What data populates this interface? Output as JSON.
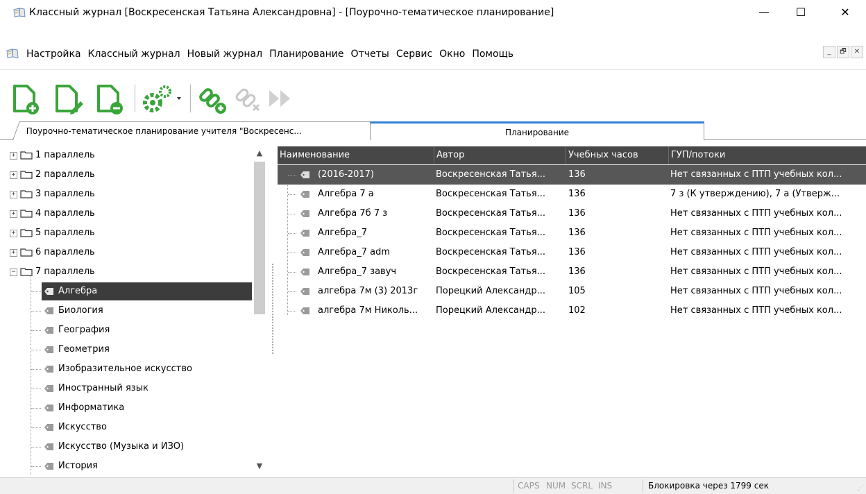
{
  "window": {
    "title": "Классный журнал [Воскресенская  Татьяна  Александровна] - [Поурочно-тематическое планирование]",
    "minimize": "—",
    "maximize": "☐",
    "close": "✕"
  },
  "menu": {
    "items": [
      "Настройка",
      "Классный журнал",
      "Новый журнал",
      "Планирование",
      "Отчеты",
      "Сервис",
      "Окно",
      "Помощь"
    ],
    "mdi_minimize": "_",
    "mdi_restore": "🗗",
    "mdi_close": "✕"
  },
  "toolbar": {
    "icons": [
      "add-document-icon",
      "edit-document-icon",
      "remove-document-icon",
      "settings-gears-icon",
      "add-link-icon",
      "remove-link-icon",
      "forward-icon"
    ],
    "accent_color": "#3aa53a"
  },
  "tabs": [
    {
      "label": "Поурочно-тематическое планирование учителя \"Воскресенс...",
      "active": false
    },
    {
      "label": "Планирование",
      "active": true
    }
  ],
  "tree": {
    "parallels": [
      "1 параллель",
      "2 параллель",
      "3 параллель",
      "4 параллель",
      "5 параллель",
      "6 параллель",
      "7 параллель"
    ],
    "subjects": [
      "Алгебра",
      "Биология",
      "География",
      "Геометрия",
      "Изобразительное искусство",
      "Иностранный язык",
      "Информатика",
      "Искусство",
      "Искусство (Музыка и ИЗО)",
      "История"
    ],
    "selected_subject": "Алгебра"
  },
  "grid": {
    "columns": [
      "Наименование",
      "Автор",
      "Учебных часов",
      "ГУП/потоки"
    ],
    "rows": [
      {
        "name": "(2016-2017)",
        "author": "Воскресенская  Татья...",
        "hours": "136",
        "streams": "Нет связанных с ПТП учебных кол...",
        "selected": true
      },
      {
        "name": "Алгебра 7 а",
        "author": "Воскресенская  Татья...",
        "hours": "136",
        "streams": "7 з (К утверждению), 7 а (Утверж..."
      },
      {
        "name": "Алгебра 7б 7 з",
        "author": "Воскресенская  Татья...",
        "hours": "136",
        "streams": "Нет связанных с ПТП учебных кол..."
      },
      {
        "name": "Алгебра_7",
        "author": "Воскресенская  Татья...",
        "hours": "136",
        "streams": "Нет связанных с ПТП учебных кол..."
      },
      {
        "name": "Алгебра_7 adm",
        "author": "Воскресенская  Татья...",
        "hours": "136",
        "streams": "Нет связанных с ПТП учебных кол..."
      },
      {
        "name": "Алгебра_7 завуч",
        "author": "Воскресенская  Татья...",
        "hours": "136",
        "streams": "Нет связанных с ПТП учебных кол..."
      },
      {
        "name": "алгебра 7м (3) 2013г",
        "author": "Порецкий  Александр...",
        "hours": "105",
        "streams": "Нет связанных с ПТП учебных кол..."
      },
      {
        "name": "алгебра 7м Николь...",
        "author": "Порецкий  Александр...",
        "hours": "102",
        "streams": "Нет связанных с ПТП учебных кол..."
      }
    ]
  },
  "status": {
    "caps": "CAPS",
    "num": "NUM",
    "scrl": "SCRL",
    "ins": "INS",
    "lock": "Блокировка через 1799 сек"
  }
}
